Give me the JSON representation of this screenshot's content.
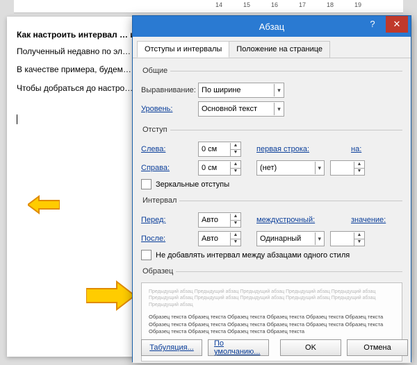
{
  "ruler": {
    "ticks": [
      "14",
      "15",
      "16",
      "17",
      "18",
      "19"
    ]
  },
  "document": {
    "heading": "Как настроить интервал … интервал между абзацами …",
    "p1": "Полученный недавно по эл… документа (техническая сто… междустрочном интервале.",
    "p2": "В качестве примера, будем… часть текста, который мы сей…",
    "p3": "Чтобы добраться до настро… усилия в виде открывания … конечном счёте, оказаться в … нужно."
  },
  "dialog": {
    "title": "Абзац",
    "help": "?",
    "close": "✕",
    "tabs": {
      "tab1": "Отступы и интервалы",
      "tab2": "Положение на странице"
    },
    "group_general": "Общие",
    "align_label": "Выравнивание:",
    "align_value": "По ширине",
    "level_label": "Уровень:",
    "level_value": "Основной текст",
    "group_indent": "Отступ",
    "left_label": "Слева:",
    "left_value": "0 см",
    "right_label": "Справа:",
    "right_value": "0 см",
    "first_line_label": "первая строка:",
    "first_line_value": "(нет)",
    "on_label": "на:",
    "on_value": "",
    "mirror": "Зеркальные отступы",
    "group_spacing": "Интервал",
    "before_label": "Перед:",
    "before_value": "Авто",
    "after_label": "После:",
    "after_value": "Авто",
    "line_label": "междустрочный:",
    "line_value": "Одинарный",
    "value_label": "значение:",
    "value_value": "",
    "same_style": "Не добавлять интервал между абзацами одного стиля",
    "group_preview": "Образец",
    "preview_faint": "Предыдущий абзац Предыдущий абзац Предыдущий абзац Предыдущий абзац Предыдущий абзац Предыдущий абзац Предыдущий абзац Предыдущий абзац Предыдущий абзац Предыдущий абзац Предыдущий абзац",
    "preview_sample": "Образец текста Образец текста Образец текста Образец текста Образец текста Образец текста Образец текста Образец текста Образец текста Образец текста Образец текста Образец текста Образец текста Образец текста Образец текста Образец текста",
    "tabulation": "Табуляция...",
    "default": "По умолчанию...",
    "ok": "OK",
    "cancel": "Отмена"
  }
}
